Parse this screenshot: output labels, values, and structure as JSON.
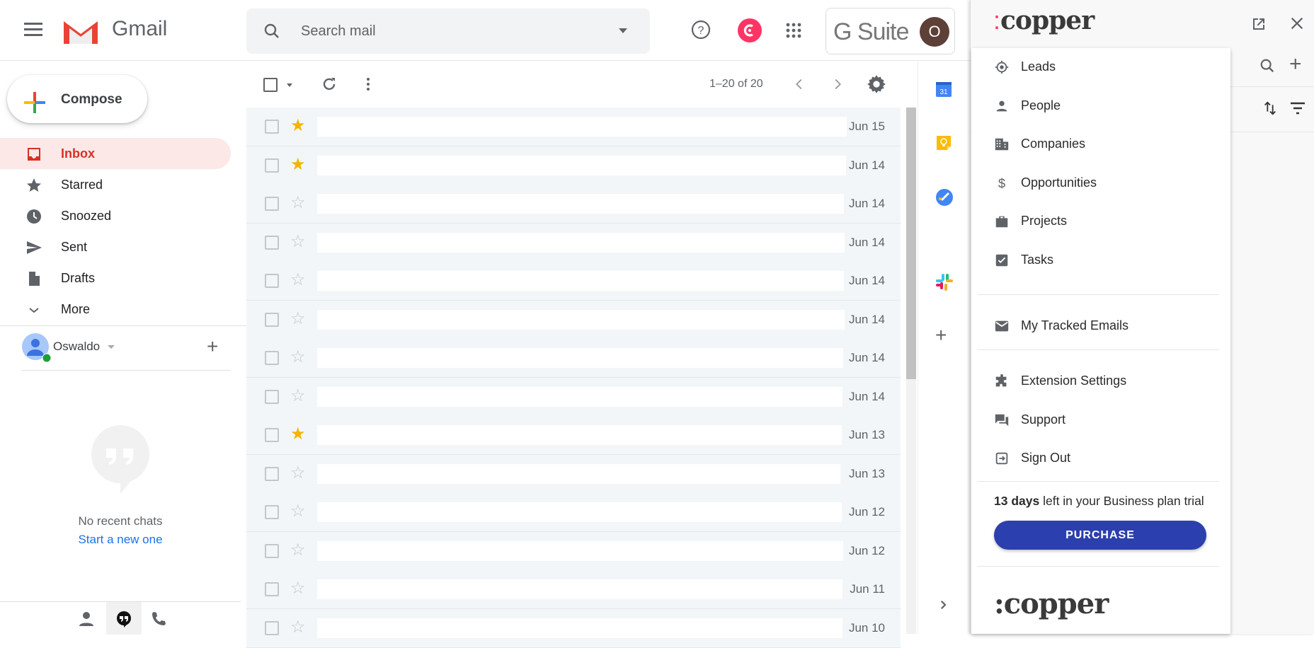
{
  "header": {
    "app_name": "Gmail",
    "search_placeholder": "Search mail",
    "gsuite_label": "G Suite",
    "avatar_initial": "O"
  },
  "sidebar": {
    "compose_label": "Compose",
    "items": [
      {
        "label": "Inbox",
        "icon": "inbox-icon",
        "active": true
      },
      {
        "label": "Starred",
        "icon": "star-icon"
      },
      {
        "label": "Snoozed",
        "icon": "clock-icon"
      },
      {
        "label": "Sent",
        "icon": "send-icon"
      },
      {
        "label": "Drafts",
        "icon": "draft-icon"
      },
      {
        "label": "More",
        "icon": "chevron-down-icon"
      }
    ],
    "user_name": "Oswaldo",
    "chat_empty_text": "No recent chats",
    "chat_start_link": "Start a new one"
  },
  "toolbar": {
    "pagination": "1–20 of 20"
  },
  "emails": [
    {
      "date": "Jun 15",
      "starred": true
    },
    {
      "date": "Jun 14",
      "starred": true
    },
    {
      "date": "Jun 14",
      "starred": false
    },
    {
      "date": "Jun 14",
      "starred": false
    },
    {
      "date": "Jun 14",
      "starred": false
    },
    {
      "date": "Jun 14",
      "starred": false
    },
    {
      "date": "Jun 14",
      "starred": false
    },
    {
      "date": "Jun 14",
      "starred": false
    },
    {
      "date": "Jun 13",
      "starred": true
    },
    {
      "date": "Jun 13",
      "starred": false
    },
    {
      "date": "Jun 12",
      "starred": false
    },
    {
      "date": "Jun 12",
      "starred": false
    },
    {
      "date": "Jun 11",
      "starred": false
    },
    {
      "date": "Jun 10",
      "starred": false
    }
  ],
  "copper": {
    "logo_text": "copper",
    "menu_group1": [
      {
        "label": "Leads",
        "icon": "target-icon"
      },
      {
        "label": "People",
        "icon": "person-icon"
      },
      {
        "label": "Companies",
        "icon": "building-icon"
      },
      {
        "label": "Opportunities",
        "icon": "dollar-icon"
      },
      {
        "label": "Projects",
        "icon": "briefcase-icon"
      },
      {
        "label": "Tasks",
        "icon": "checkbox-icon"
      }
    ],
    "menu_group2": [
      {
        "label": "My Tracked Emails",
        "icon": "mail-icon"
      }
    ],
    "menu_group3": [
      {
        "label": "Extension Settings",
        "icon": "puzzle-icon"
      },
      {
        "label": "Support",
        "icon": "forum-icon"
      },
      {
        "label": "Sign Out",
        "icon": "sign-out-icon"
      }
    ],
    "trial_bold": "13 days",
    "trial_rest": " left in your Business plan trial",
    "purchase_label": "PURCHASE",
    "brand_color": "#2b3fae",
    "accent_color": "#ff3465"
  }
}
